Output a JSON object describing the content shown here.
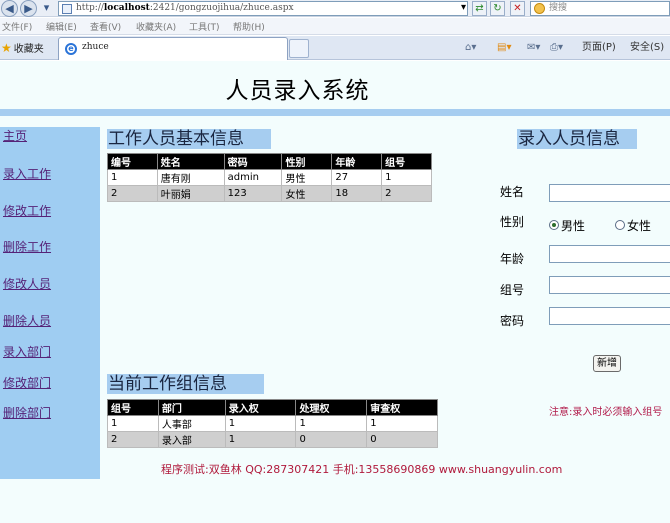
{
  "browser": {
    "url_prefix": "http://",
    "url_host": "localhost",
    "url_rest": ":2421/gongzuojihua/zhuce.aspx",
    "search_placeholder": "搜搜",
    "menu": [
      "文件(F)",
      "编辑(E)",
      "查看(V)",
      "收藏夹(A)",
      "工具(T)",
      "帮助(H)"
    ],
    "favorites_label": "收藏夹",
    "tab_label": "zhuce",
    "page_menu": "页面(P)",
    "safety_menu": "安全(S)"
  },
  "page": {
    "title": "人员录入系统",
    "sidebar": [
      {
        "label": "主页"
      },
      {
        "label": "录入工作"
      },
      {
        "label": "修改工作"
      },
      {
        "label": "删除工作"
      },
      {
        "label": "修改人员"
      },
      {
        "label": "删除人员"
      },
      {
        "label": "录入部门"
      },
      {
        "label": "修改部门"
      },
      {
        "label": "删除部门"
      }
    ],
    "staff_section": {
      "title": "工作人员基本信息",
      "columns": [
        "编号",
        "姓名",
        "密码",
        "性别",
        "年龄",
        "组号"
      ],
      "rows": [
        [
          "1",
          "唐有刚",
          "admin",
          "男性",
          "27",
          "1"
        ],
        [
          "2",
          "叶丽娟",
          "123",
          "女性",
          "18",
          "2"
        ]
      ]
    },
    "group_section": {
      "title": "当前工作组信息",
      "columns": [
        "组号",
        "部门",
        "录入权",
        "处理权",
        "审查权"
      ],
      "rows": [
        [
          "1",
          "人事部",
          "1",
          "1",
          "1"
        ],
        [
          "2",
          "录入部",
          "1",
          "0",
          "0"
        ]
      ]
    },
    "form": {
      "title": "录入人员信息",
      "name_label": "姓名",
      "gender_label": "性别",
      "gender_male": "男性",
      "gender_female": "女性",
      "age_label": "年龄",
      "group_label": "组号",
      "password_label": "密码",
      "submit_label": "新增",
      "required_note": "注意:录入时必须输入组号",
      "name_value": "",
      "age_value": "",
      "group_value": "",
      "password_value": ""
    },
    "footer": "程序测试:双鱼林 QQ:287307421 手机:13558690869 www.shuangyulin.com"
  }
}
